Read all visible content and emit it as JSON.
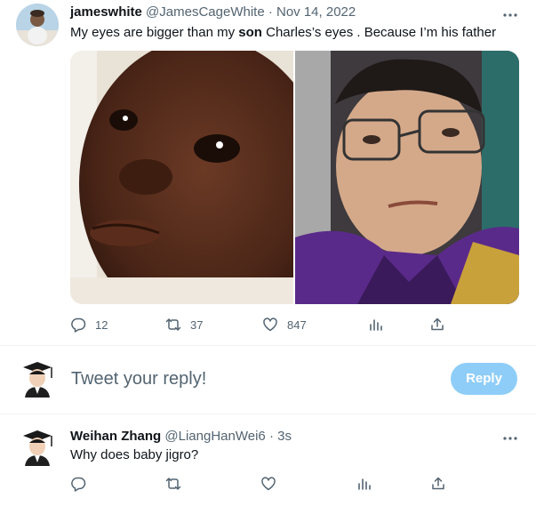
{
  "tweet": {
    "display_name": "jameswhite",
    "handle": "@JamesCageWhite",
    "separator": "·",
    "date": "Nov 14, 2022",
    "text_before": "My eyes are bigger than my ",
    "text_bold": "son",
    "text_after": " Charles’s eyes . Because I’m his father",
    "stats": {
      "replies": "12",
      "retweets": "37",
      "likes": "847"
    },
    "media": [
      {
        "icon": "baby-photo"
      },
      {
        "icon": "man-with-glasses-photo"
      }
    ]
  },
  "reply_box": {
    "placeholder": "Tweet your reply!",
    "button_label": "Reply",
    "button_color": "#8ecdf8"
  },
  "reply": {
    "display_name": "Weihan Zhang",
    "handle": "@LiangHanWei6",
    "separator": "·",
    "time": "3s",
    "text": "Why does baby jigro?"
  },
  "icons": {
    "more": "more-dots-icon",
    "reply": "reply-icon",
    "retweet": "retweet-icon",
    "like": "heart-icon",
    "views": "analytics-icon",
    "share": "share-icon"
  },
  "colors": {
    "text_primary": "#0f1419",
    "text_secondary": "#536471",
    "divider": "#eff3f4"
  }
}
